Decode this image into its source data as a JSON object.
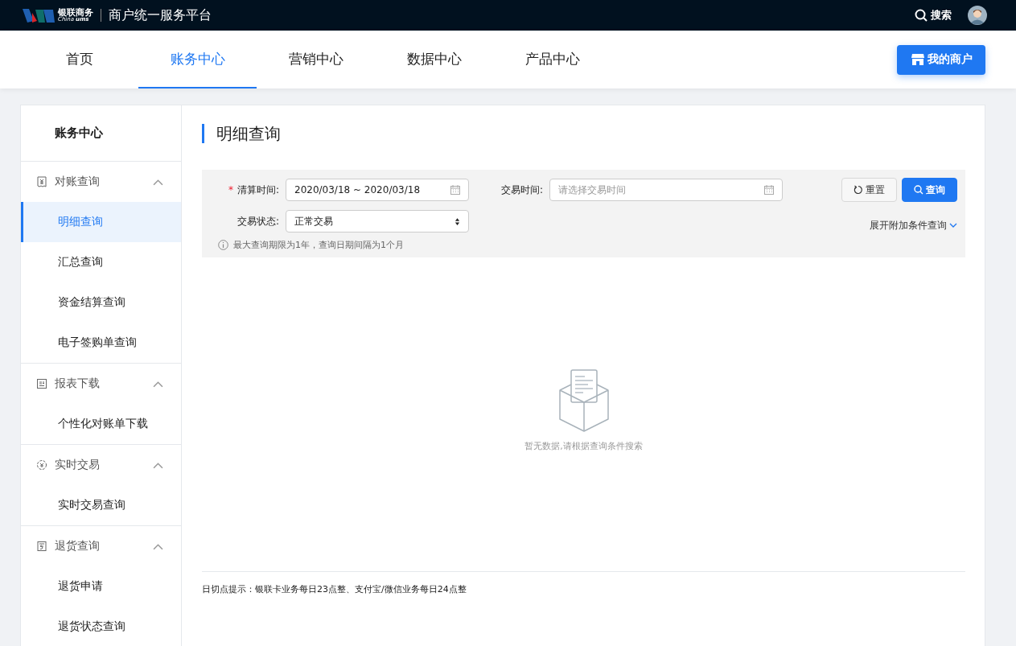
{
  "header": {
    "logo_cn": "银联商务",
    "logo_en_1": "China",
    "logo_en_2": "ums",
    "platform": "商户统一服务平台",
    "search": "搜索"
  },
  "nav": {
    "tabs": [
      {
        "label": "首页",
        "selected": false
      },
      {
        "label": "账务中心",
        "selected": true
      },
      {
        "label": "营销中心",
        "selected": false
      },
      {
        "label": "数据中心",
        "selected": false
      },
      {
        "label": "产品中心",
        "selected": false
      }
    ],
    "merchant_button": "我的商户"
  },
  "sidebar": {
    "title": "账务中心",
    "groups": [
      {
        "label": "对账查询",
        "kind": "receipt",
        "expanded": true,
        "items": [
          {
            "label": "明细查询",
            "selected": true
          },
          {
            "label": "汇总查询",
            "selected": false
          },
          {
            "label": "资金结算查询",
            "selected": false
          },
          {
            "label": "电子签购单查询",
            "selected": false
          }
        ]
      },
      {
        "label": "报表下载",
        "kind": "report",
        "expanded": true,
        "items": [
          {
            "label": "个性化对账单下载",
            "selected": false
          }
        ]
      },
      {
        "label": "实时交易",
        "kind": "money",
        "expanded": true,
        "items": [
          {
            "label": "实时交易查询",
            "selected": false
          }
        ]
      },
      {
        "label": "退货查询",
        "kind": "return",
        "expanded": true,
        "items": [
          {
            "label": "退货申请",
            "selected": false
          },
          {
            "label": "退货状态查询",
            "selected": false
          }
        ]
      }
    ]
  },
  "page": {
    "title": "明细查询",
    "filters": {
      "required_mark": "*",
      "settle_label": "清算时间:",
      "settle_value": "2020/03/18 ~ 2020/03/18",
      "trade_time_label": "交易时间:",
      "trade_time_placeholder": "请选择交易时间",
      "status_label": "交易状态:",
      "status_value": "正常交易",
      "reset": "重置",
      "query": "查询",
      "expand": "展开附加条件查询",
      "hint": "最大查询期限为1年，查询日期间隔为1个月"
    },
    "empty": "暂无数据,请根据查询条件搜索",
    "footer_note": "日切点提示：银联卡业务每日23点整、支付宝/微信业务每日24点整"
  }
}
